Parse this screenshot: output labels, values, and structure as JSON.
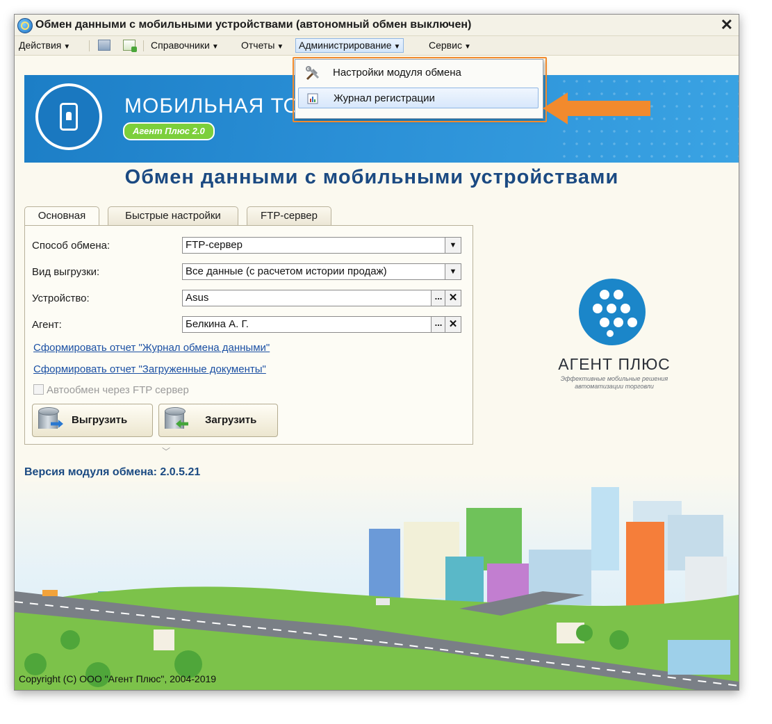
{
  "window": {
    "title": "Обмен данными с мобильными устройствами (автономный обмен выключен)",
    "close": "✕"
  },
  "menu": {
    "actions": "Действия",
    "references": "Справочники",
    "reports": "Отчеты",
    "administration": "Администрирование",
    "service": "Сервис"
  },
  "dropdown": {
    "items": [
      {
        "label": "Настройки модуля обмена",
        "icon": "tools-icon"
      },
      {
        "label": "Журнал регистрации",
        "icon": "log-journal-icon"
      }
    ]
  },
  "banner": {
    "title": "МОБИЛЬНАЯ ТОРГ",
    "badge": "Агент Плюс 2.0"
  },
  "page": {
    "heading": "Обмен данными с мобильными устройствами"
  },
  "tabs": [
    "Основная",
    "Быстрые настройки",
    "FTP-сервер"
  ],
  "form": {
    "exchange_method": {
      "label": "Способ обмена:",
      "value": "FTP-сервер"
    },
    "export_type": {
      "label": "Вид выгрузки:",
      "value": "Все данные (с расчетом истории продаж)"
    },
    "device": {
      "label": "Устройство:",
      "value": "Asus"
    },
    "agent": {
      "label": "Агент:",
      "value": "Белкина А. Г."
    },
    "link_exchange_log": "Сформировать отчет \"Журнал обмена данными\"",
    "link_loaded_docs": "Сформировать отчет \"Загруженные документы\"",
    "auto_exchange": {
      "label": "Автообмен через FTP сервер",
      "checked": false,
      "enabled": false
    },
    "export_button": "Выгрузить",
    "import_button": "Загрузить"
  },
  "version": "Версия модуля обмена: 2.0.5.21",
  "logo": {
    "name": "АГЕНТ ПЛЮС",
    "tagline_1": "Эффективные мобильные решения",
    "tagline_2": "автоматизации торговли"
  },
  "copyright": "Copyright (C) ООО \"Агент Плюс\", 2004-2019",
  "colors": {
    "accent_orange": "#f28a2d",
    "brand_blue": "#1b86c9",
    "heading_blue": "#1b4a82",
    "badge_green": "#7ccf3b"
  }
}
